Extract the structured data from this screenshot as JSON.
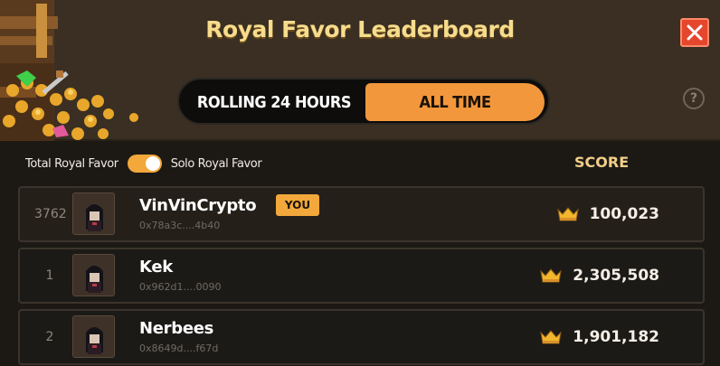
{
  "header": {
    "title": "Royal Favor Leaderboard",
    "close_icon": "close-icon",
    "help_label": "?"
  },
  "tabs": [
    {
      "label": "ROLLING 24 HOURS",
      "selected": false
    },
    {
      "label": "ALL TIME",
      "selected": true
    }
  ],
  "filter": {
    "left_label": "Total Royal Favor",
    "right_label": "Solo Royal Favor",
    "toggle_on": true
  },
  "columns": {
    "score": "SCORE"
  },
  "rows": [
    {
      "rank": "3762",
      "name": "VinVinCrypto",
      "address": "0x78a3c....4b40",
      "score": "100,023",
      "is_you": true,
      "badge": "YOU"
    },
    {
      "rank": "1",
      "name": "Kek",
      "address": "0x962d1....0090",
      "score": "2,305,508",
      "is_you": false
    },
    {
      "rank": "2",
      "name": "Nerbees",
      "address": "0x8649d....f67d",
      "score": "1,901,182",
      "is_you": false
    }
  ],
  "colors": {
    "accent": "#f2973c",
    "close": "#e4472e",
    "title": "#f7dc8c"
  }
}
